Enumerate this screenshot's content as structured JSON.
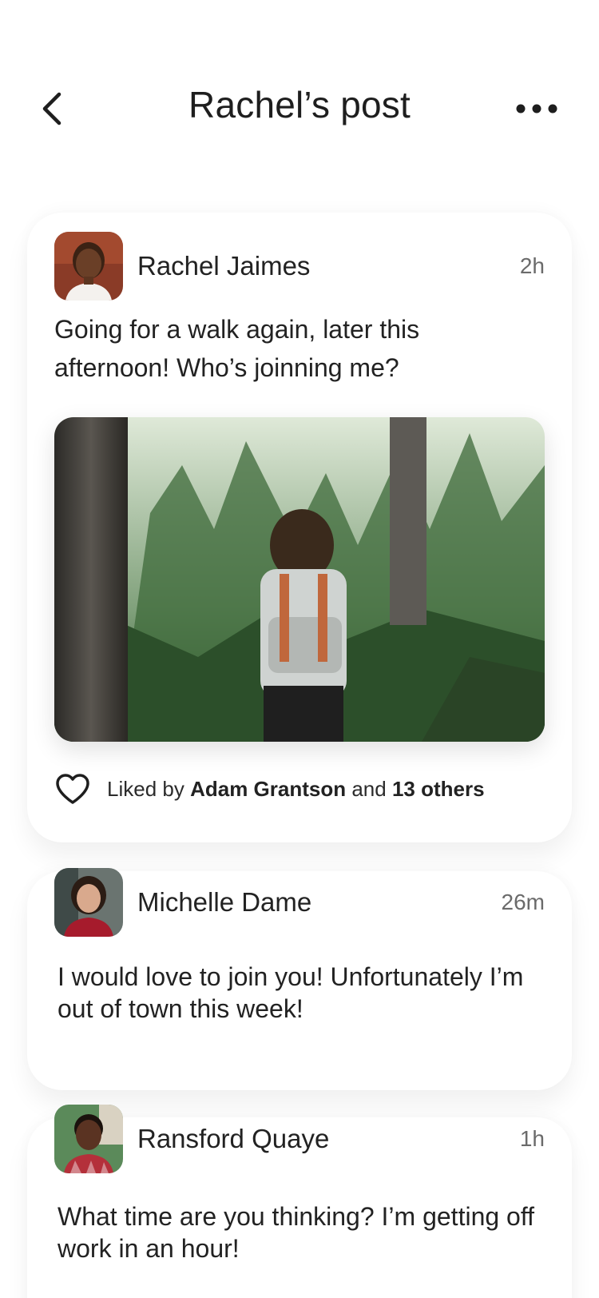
{
  "header": {
    "title": "Rachel’s post",
    "back_icon": "chevron-left-icon",
    "more_icon": "more-horizontal-icon"
  },
  "post": {
    "author": "Rachel Jaimes",
    "time": "2h",
    "text": "Going for a walk again, later this afternoon! Who’s joinning me?",
    "image_subject": "hiker-in-forest-photo",
    "likes": {
      "prefix": "Liked by",
      "liker": "Adam Grantson",
      "conjunction": "and",
      "others": "13 others"
    }
  },
  "comments": [
    {
      "author": "Michelle Dame",
      "time": "26m",
      "text": "I would love to join you! Unfortunately I’m out of town this week!"
    },
    {
      "author": "Ransford Quaye",
      "time": "1h",
      "text": "What time are you thinking? I’m getting off work in an hour!"
    }
  ],
  "colors": {
    "text_primary": "#222222",
    "text_secondary": "#6b6b6b",
    "card_background": "#ffffff"
  }
}
